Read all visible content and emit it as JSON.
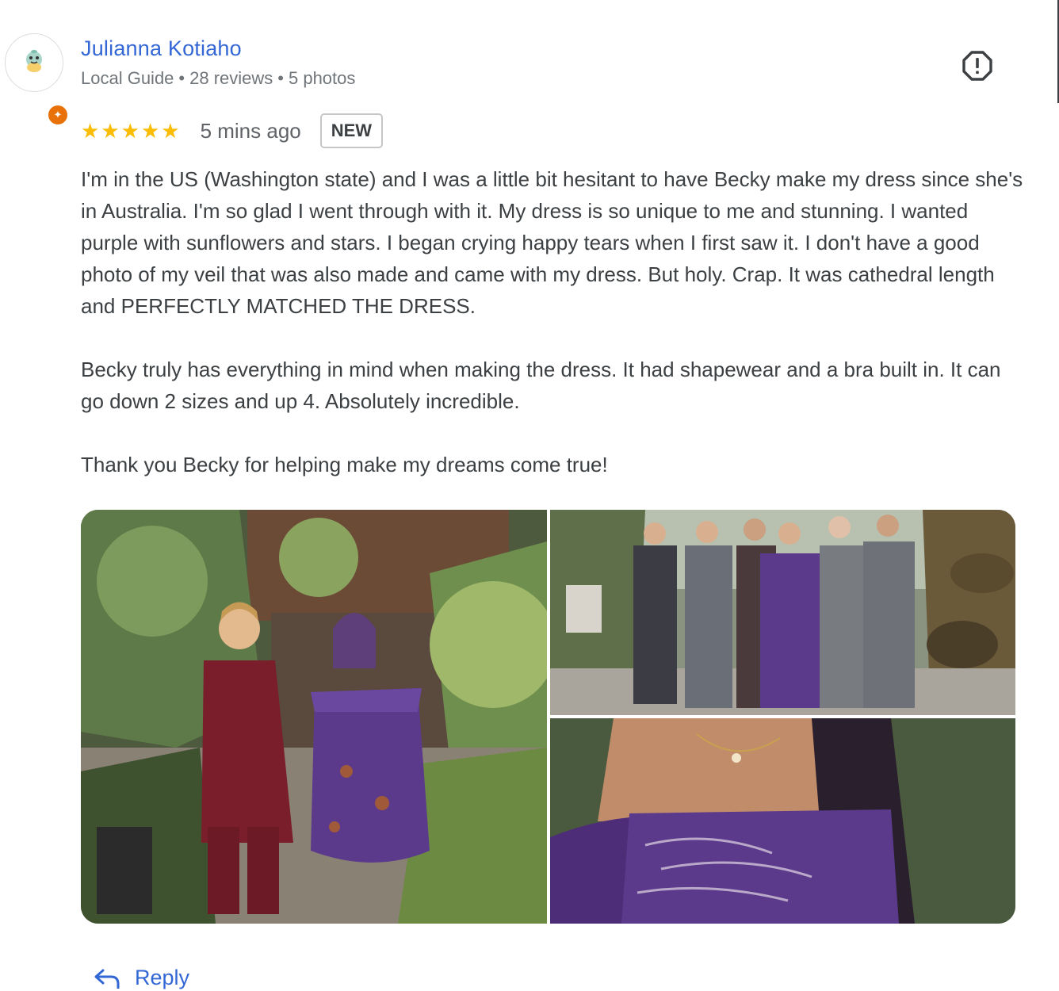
{
  "author": {
    "name": "Julianna Kotiaho",
    "badge": "Local Guide",
    "reviews": "28 reviews",
    "photos": "5 photos",
    "separator": "•",
    "badge_color": "#e8710a",
    "link_color": "#3367d6"
  },
  "report_icon": "report-icon",
  "rating": {
    "stars": 5,
    "star_glyphs": [
      "★",
      "★",
      "★",
      "★",
      "★"
    ],
    "star_color": "#fbbc04",
    "time_ago": "5 mins ago",
    "badge": "NEW"
  },
  "review": {
    "paragraphs": [
      "I'm in the US (Washington state) and I was a little bit hesitant to have Becky make my dress since she's in Australia. I'm so glad I went through with it. My dress is so unique to me and stunning. I wanted purple with sunflowers and stars. I began crying happy tears when I first saw it. I don't have a good photo of my veil that was also made and came with my dress. But holy. Crap. It was cathedral length and PERFECTLY MATCHED THE DRESS.",
      "Becky truly has everything in mind when making the dress. It had shapewear and a bra built in. It can go down 2 sizes and up 4. Absolutely incredible.",
      "Thank you Becky for helping make my dreams come true!"
    ]
  },
  "reply": {
    "label": "Reply",
    "icon": "reply-arrow-icon"
  }
}
